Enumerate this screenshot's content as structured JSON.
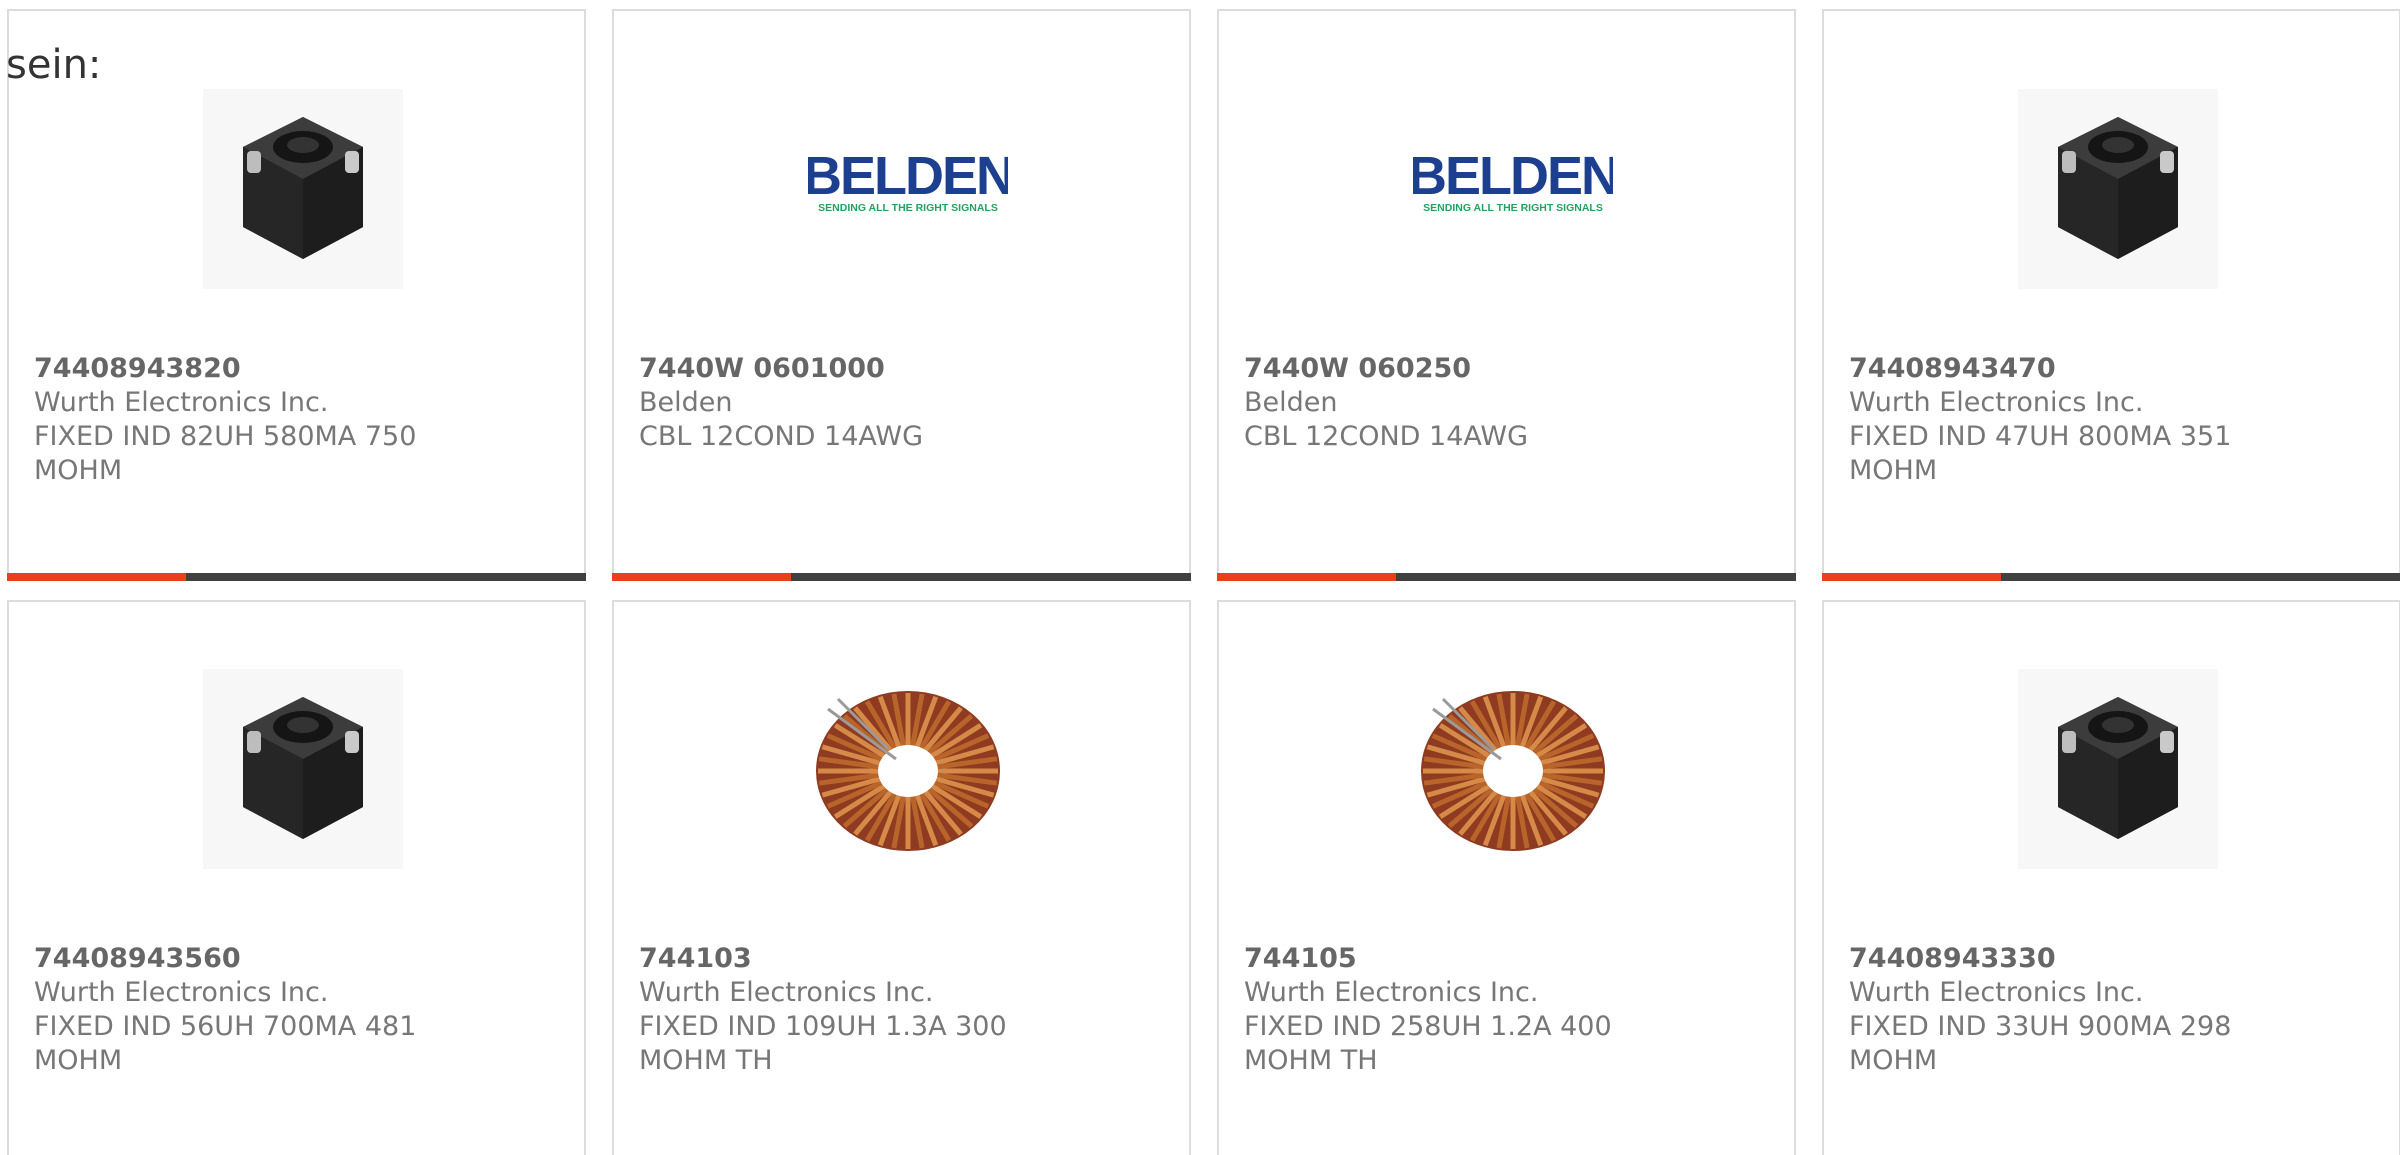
{
  "intro_text": "sein:",
  "accent_color": "#e8401a",
  "bar_track_color": "#404040",
  "cards": [
    {
      "part_number": "74408943820",
      "manufacturer": "Wurth Electronics Inc.",
      "description": "FIXED IND 82UH 580MA 750 MOHM",
      "image": "smd-inductor-image",
      "progress_fraction": 0.31
    },
    {
      "part_number": "7440W 0601000",
      "manufacturer": "Belden",
      "description": "CBL 12COND 14AWG",
      "image": "belden-logo",
      "logo_text": "BELDEN",
      "logo_tagline": "SENDING ALL THE RIGHT SIGNALS",
      "progress_fraction": 0.31
    },
    {
      "part_number": "7440W 060250",
      "manufacturer": "Belden",
      "description": "CBL 12COND 14AWG",
      "image": "belden-logo",
      "logo_text": "BELDEN",
      "logo_tagline": "SENDING ALL THE RIGHT SIGNALS",
      "progress_fraction": 0.31
    },
    {
      "part_number": "74408943470",
      "manufacturer": "Wurth Electronics Inc.",
      "description": "FIXED IND 47UH 800MA 351 MOHM",
      "image": "smd-inductor-image",
      "progress_fraction": 0.31
    },
    {
      "part_number": "74408943560",
      "manufacturer": "Wurth Electronics Inc.",
      "description": "FIXED IND 56UH 700MA 481 MOHM",
      "image": "smd-inductor-image"
    },
    {
      "part_number": "744103",
      "manufacturer": "Wurth Electronics Inc.",
      "description": "FIXED IND 109UH 1.3A 300 MOHM TH",
      "image": "toroid-inductor-image"
    },
    {
      "part_number": "744105",
      "manufacturer": "Wurth Electronics Inc.",
      "description": "FIXED IND 258UH 1.2A 400 MOHM TH",
      "image": "toroid-inductor-image"
    },
    {
      "part_number": "74408943330",
      "manufacturer": "Wurth Electronics Inc.",
      "description": "FIXED IND 33UH 900MA 298 MOHM",
      "image": "smd-inductor-image"
    }
  ]
}
